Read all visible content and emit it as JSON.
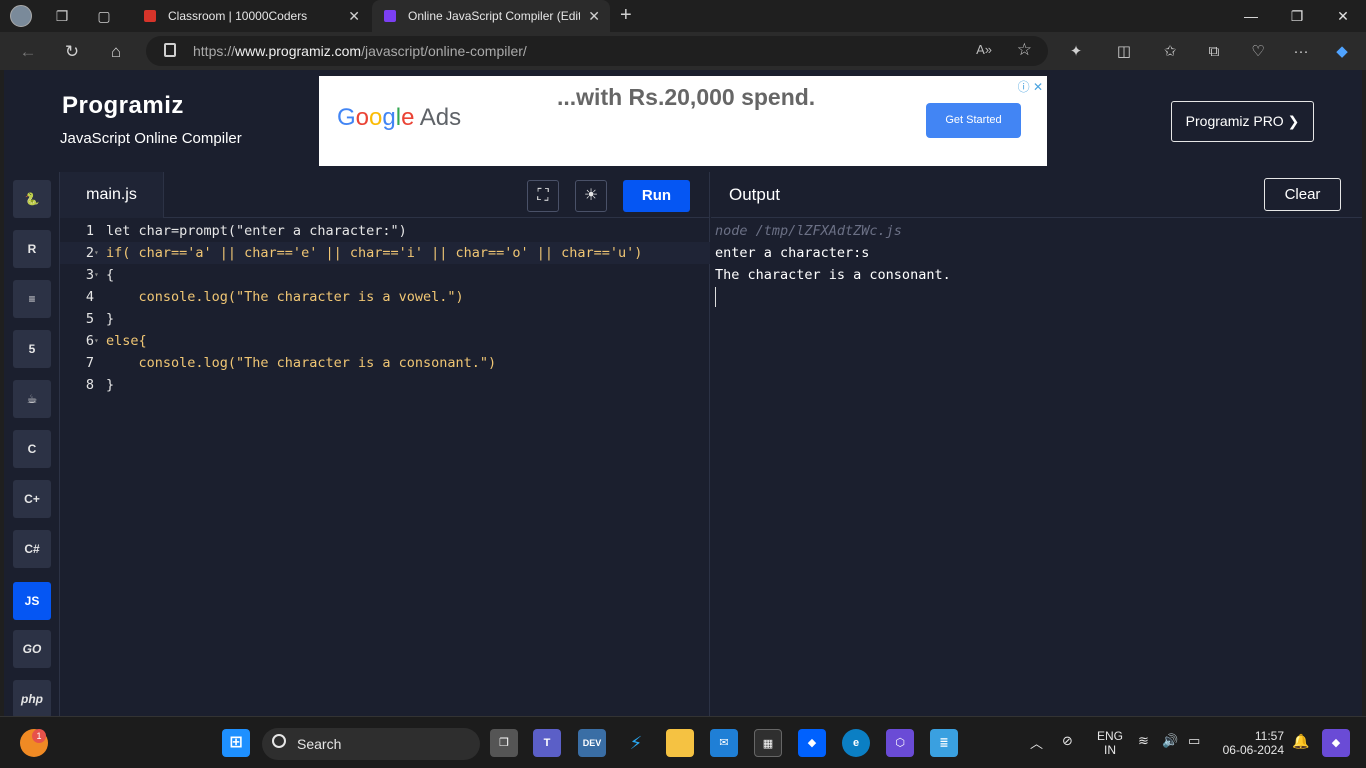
{
  "browser": {
    "tabs": [
      {
        "title": "Classroom | 10000Coders",
        "active": false
      },
      {
        "title": "Online JavaScript Compiler (Edito",
        "active": true
      }
    ],
    "url_prefix": "https://",
    "url_domain": "www.programiz.com",
    "url_path": "/javascript/online-compiler/"
  },
  "header": {
    "logo": "Programiz",
    "subtitle": "JavaScript Online Compiler",
    "pro_button": "Programiz PRO ❯"
  },
  "ad": {
    "brand": "Google Ads",
    "headline": "...with Rs.20,000 spend.",
    "cta": "Get Started"
  },
  "sidebar": {
    "languages": [
      {
        "name": "python",
        "label": "py"
      },
      {
        "name": "r",
        "label": "R"
      },
      {
        "name": "sql",
        "label": "SQL"
      },
      {
        "name": "html",
        "label": "5"
      },
      {
        "name": "java",
        "label": "☕"
      },
      {
        "name": "c",
        "label": "C"
      },
      {
        "name": "cpp",
        "label": "C+"
      },
      {
        "name": "csharp",
        "label": "C#"
      },
      {
        "name": "js",
        "label": "JS",
        "active": true
      },
      {
        "name": "go",
        "label": "GO"
      },
      {
        "name": "php",
        "label": "php"
      }
    ]
  },
  "editor": {
    "file_name": "main.js",
    "run_label": "Run",
    "lines": [
      {
        "n": "1",
        "text": "let char=prompt(\"enter a character:\")"
      },
      {
        "n": "2",
        "text": "if( char=='a' || char=='e' || char=='i' || char=='o' || char=='u')"
      },
      {
        "n": "3",
        "text": "{"
      },
      {
        "n": "4",
        "text": "    console.log(\"The character is a vowel.\")"
      },
      {
        "n": "5",
        "text": "}"
      },
      {
        "n": "6",
        "text": "else{"
      },
      {
        "n": "7",
        "text": "    console.log(\"The character is a consonant.\")"
      },
      {
        "n": "8",
        "text": "}"
      }
    ]
  },
  "output": {
    "title": "Output",
    "clear_label": "Clear",
    "command": "node /tmp/lZFXAdtZWc.js",
    "lines": [
      "enter a character:s",
      "The character is a consonant."
    ]
  },
  "taskbar": {
    "search_label": "Search",
    "notification_count": "1",
    "lang_line1": "ENG",
    "lang_line2": "IN",
    "time": "11:57",
    "date": "06-06-2024"
  },
  "colors": {
    "run_button": "#0556f3",
    "page_bg": "#1b1f2e"
  }
}
